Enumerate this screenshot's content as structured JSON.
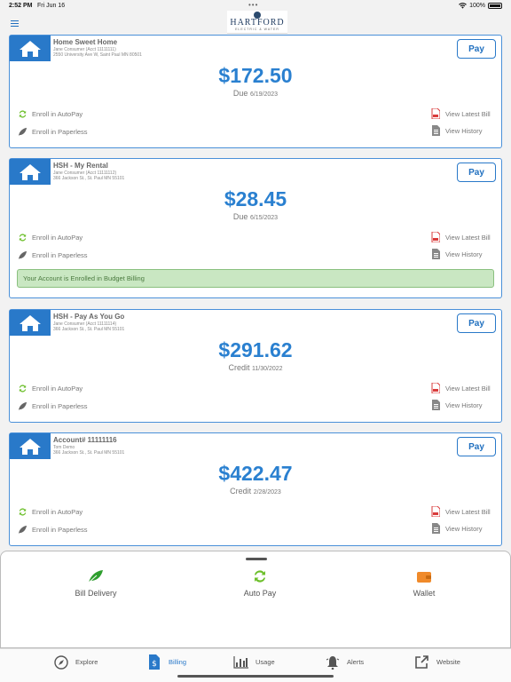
{
  "status_bar": {
    "time": "2:52 PM",
    "date": "Fri Jun 16",
    "battery": "100%"
  },
  "header": {
    "logo_name": "HARTFORD",
    "logo_sub": "ELECTRIC & WATER"
  },
  "labels": {
    "pay": "Pay",
    "autopay": "Enroll in AutoPay",
    "paperless": "Enroll in Paperless",
    "view_latest_bill": "View Latest Bill",
    "view_history": "View History"
  },
  "accounts": [
    {
      "title": "Home Sweet Home",
      "line1": "Jane Consumer (Acct 11111111)",
      "line2": "2550 University Ave W, Saint Paul MN 80501",
      "amount": "$172.50",
      "status": "Due",
      "date": "6/19/2023"
    },
    {
      "title": "HSH - My Rental",
      "line1": "Jane Consumer (Acct 11111112)",
      "line2": "366 Jackson St., St. Paul MN 55101",
      "amount": "$28.45",
      "status": "Due",
      "date": "6/15/2023",
      "banner": "Your Account is Enrolled in Budget Billing"
    },
    {
      "title": "HSH - Pay As You Go",
      "line1": "Jane Consumer (Acct 11111114)",
      "line2": "366 Jackson St., St. Paul MN 55101",
      "amount": "$291.62",
      "status": "Credit",
      "date": "11/30/2022"
    },
    {
      "title": "Account# 11111116",
      "line1": "Tom Demo",
      "line2": "366 Jackson St., St. Paul MN 55101",
      "amount": "$422.47",
      "status": "Credit",
      "date": "2/28/2023"
    }
  ],
  "sheet": {
    "items": [
      "Bill Delivery",
      "Auto Pay",
      "Wallet"
    ]
  },
  "tabs": [
    "Explore",
    "Billing",
    "Usage",
    "Alerts",
    "Website"
  ],
  "active_tab": "Billing",
  "colors": {
    "primary": "#2979c9",
    "amount": "#2a80d0",
    "banner_bg": "#c9e7c2",
    "green": "#6cbf2a",
    "pdf_red": "#d93b3b",
    "wallet_orange": "#f08a2a"
  }
}
